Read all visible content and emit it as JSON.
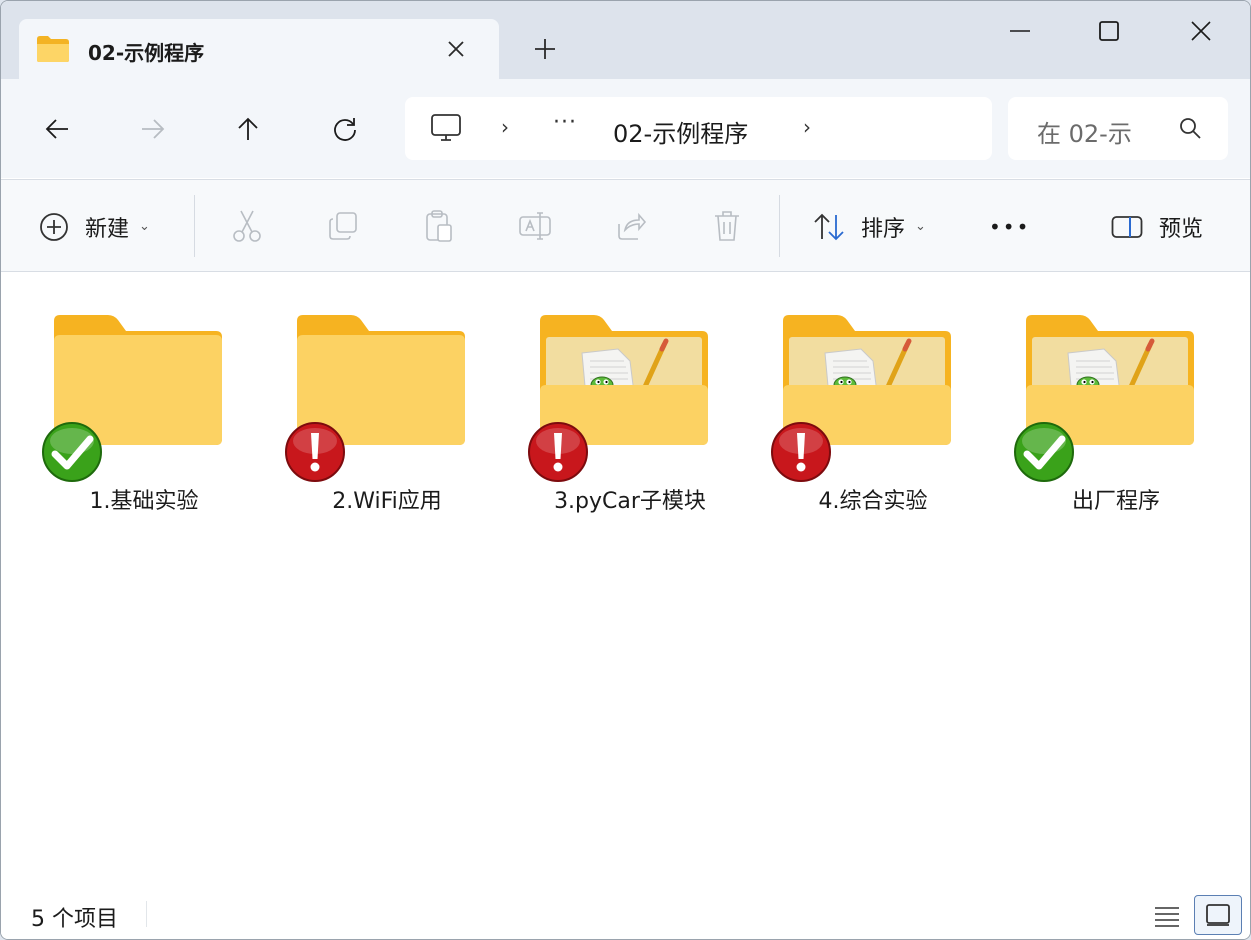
{
  "window": {
    "tab_title": "02-示例程序"
  },
  "address": {
    "more": "···",
    "current_folder": "02-示例程序",
    "search_placeholder": "在 02-示"
  },
  "commandbar": {
    "new_label": "新建",
    "sort_label": "排序",
    "more_label": "•••",
    "preview_label": "预览"
  },
  "items": [
    {
      "label": "1.基础实验",
      "badge": "check",
      "style": "plain"
    },
    {
      "label": "2.WiFi应用",
      "badge": "warning",
      "style": "plain"
    },
    {
      "label": "3.pyCar子模块",
      "badge": "warning",
      "style": "python"
    },
    {
      "label": "4.综合实验",
      "badge": "warning",
      "style": "python"
    },
    {
      "label": "出厂程序",
      "badge": "check",
      "style": "python"
    }
  ],
  "status": {
    "item_count": "5 个项目"
  },
  "colors": {
    "accent": "#2a6ad0",
    "folder_front": "#fcd263",
    "folder_back": "#f6b321",
    "check_green": "#3aa21a",
    "warn_red": "#c8171c"
  }
}
